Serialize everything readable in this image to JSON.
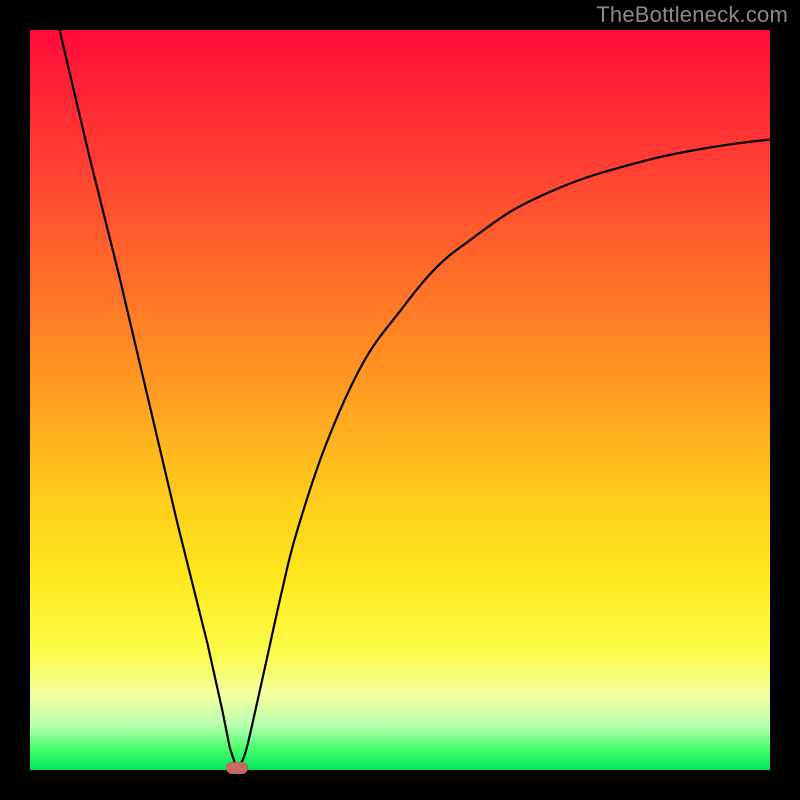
{
  "watermark": "TheBottleneck.com",
  "colors": {
    "background": "#000000",
    "curve": "#000000",
    "marker": "#c66a63",
    "gradient_stops": [
      "#ff0b3a",
      "#ff1f36",
      "#ff3e33",
      "#ff6a2a",
      "#ff9922",
      "#ffc81c",
      "#ffe81e",
      "#fcfc4a",
      "#f3ffa0",
      "#b8ffb0",
      "#4bff6e",
      "#00e85a"
    ]
  },
  "chart_data": {
    "type": "line",
    "title": "",
    "xlabel": "",
    "ylabel": "",
    "xlim": [
      0,
      100
    ],
    "ylim": [
      0,
      100
    ],
    "minimum_x": 28,
    "series": [
      {
        "name": "left-branch",
        "x": [
          4,
          8,
          12,
          16,
          20,
          24,
          26,
          27,
          28
        ],
        "values": [
          100,
          83,
          67,
          50,
          33,
          17,
          8,
          3,
          0
        ]
      },
      {
        "name": "right-branch",
        "x": [
          28,
          29,
          30,
          32,
          34,
          36,
          40,
          45,
          50,
          55,
          60,
          65,
          70,
          75,
          80,
          85,
          90,
          95,
          100
        ],
        "values": [
          0,
          2,
          6,
          15,
          24,
          32,
          44,
          55,
          62,
          68,
          72,
          75.5,
          78,
          80,
          81.5,
          82.8,
          83.8,
          84.6,
          85.2
        ]
      }
    ],
    "annotations": [
      {
        "name": "min-marker",
        "x": 28,
        "y": 0
      }
    ]
  }
}
